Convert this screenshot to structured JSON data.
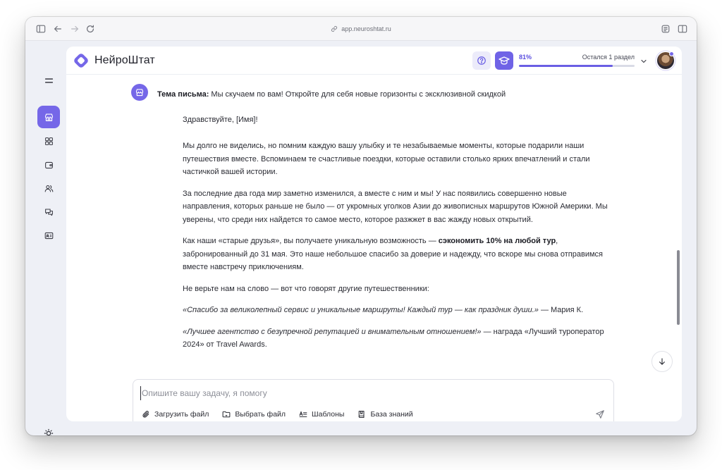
{
  "browser": {
    "url": "app.neuroshtat.ru"
  },
  "sidebar": {
    "items": [
      {
        "icon": "store-icon",
        "active": true
      },
      {
        "icon": "grid-icon",
        "active": false
      },
      {
        "icon": "wallet-icon",
        "active": false
      },
      {
        "icon": "users-icon",
        "active": false
      },
      {
        "icon": "chat-icon",
        "active": false
      },
      {
        "icon": "id-card-icon",
        "active": false
      }
    ],
    "bottom_icon": "sun-icon"
  },
  "header": {
    "brand": "НейроШтат",
    "progress_label": "81%",
    "progress_value": 0.81,
    "remaining_label": "Остался 1 раздел"
  },
  "message": {
    "subject_label": "Тема письма:",
    "subject_text": " Мы скучаем по вам! Откройте для себя новые горизонты с эксклюзивной скидкой",
    "greeting": "Здравствуйте, [Имя]!",
    "para1": "Мы долго не виделись, но помним каждую вашу улыбку и те незабываемые моменты, которые подарили наши путешествия вместе. Вспоминаем те счастливые поездки, которые оставили столько ярких впечатлений и стали частичкой вашей истории.",
    "para2": "За последние два года мир заметно изменился, а вместе с ним и мы! У нас появились совершенно новые направления, которых раньше не было — от укромных уголков Азии до живописных маршрутов Южной Америки. Мы уверены, что среди них найдется то самое место, которое разжжет в вас жажду новых открытий.",
    "para3_before": "Как наши «старые друзья», вы получаете уникальную возможность — ",
    "para3_bold": "сэкономить 10% на любой тур",
    "para3_after": ", забронированный до 31 мая. Это наше небольшое спасибо за доверие и надежду, что вскоре мы снова отправимся вместе навстречу приключениям.",
    "para4": "Не верьте нам на слово — вот что говорят другие путешественники:",
    "quote1": "«Спасибо за великолепный сервис и уникальные маршруты! Каждый тур — как праздник души.»",
    "quote1_author": " — Мария К.",
    "quote2": "«Лучшее агентство с безупречной репутацией и внимательным отношением!»",
    "quote2_after": " — награда «Лучший туроператор 2024» от Travel Awards."
  },
  "composer": {
    "placeholder": "Опишите вашу задачу, я помогу",
    "upload_label": "Загрузить файл",
    "choose_label": "Выбрать файл",
    "templates_label": "Шаблоны",
    "kb_label": "База знаний"
  },
  "colors": {
    "accent": "#7567e8",
    "accent_light": "#ecebfa",
    "window_bg": "#eef0f6"
  }
}
